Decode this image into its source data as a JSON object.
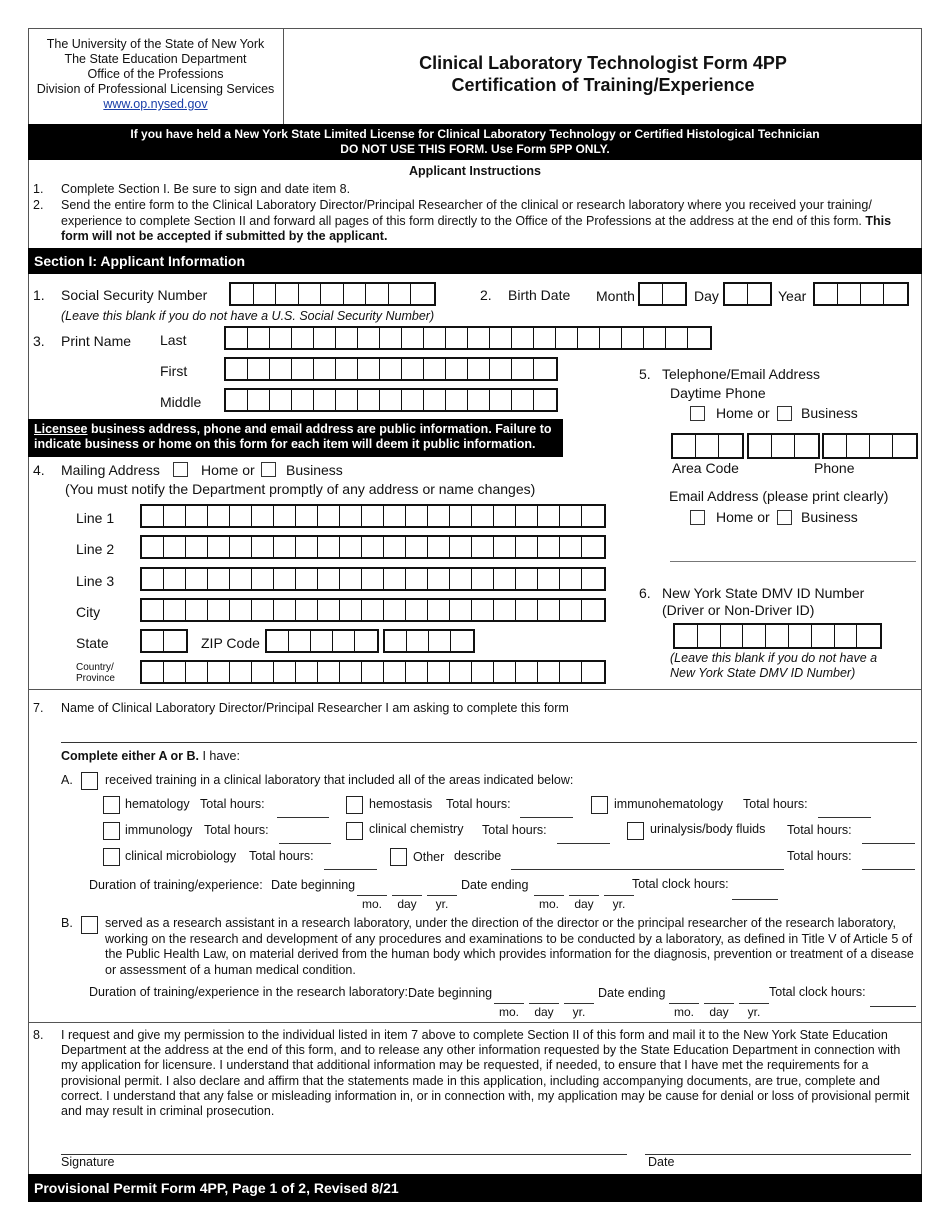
{
  "header": {
    "agency_lines": [
      "The University of the State of New York",
      "The State Education Department",
      "Office of the Professions",
      "Division of Professional Licensing Services"
    ],
    "website": "www.op.nysed.gov",
    "title_line1": "Clinical Laboratory Technologist Form 4PP",
    "title_line2": "Certification of Training/Experience"
  },
  "warning": {
    "line1": "If you have held a New York State Limited License for Clinical Laboratory Technology or Certified Histological Technician",
    "line2": "DO NOT USE THIS FORM. Use Form 5PP ONLY."
  },
  "instructions": {
    "title": "Applicant Instructions",
    "items": [
      {
        "num": "1.",
        "text": "Complete Section I. Be sure to sign and date item 8."
      },
      {
        "num": "2.",
        "text": "Send the entire form to the Clinical Laboratory Director/Principal Researcher of the clinical or research laboratory where you received your training/ experience to complete Section II and forward all pages of this form directly to the Office of the Professions at the address at the end of this form. ",
        "bold": "This form will not be accepted if submitted by the applicant."
      }
    ]
  },
  "section1": {
    "title": "Section I: Applicant Information",
    "ssn": {
      "num": "1.",
      "label": "Social Security Number",
      "note": "(Leave this blank if you do not have a U.S. Social Security Number)"
    },
    "birth": {
      "num": "2.",
      "label": "Birth Date",
      "month": "Month",
      "day": "Day",
      "year": "Year"
    },
    "name": {
      "num": "3.",
      "label": "Print Name",
      "last": "Last",
      "first": "First",
      "middle": "Middle"
    },
    "public_notice": {
      "underlined": "Licensee",
      "rest_line1": " business address, phone and email address are public information. Failure to",
      "line2": "indicate business or home on this form for each item will deem it public information."
    },
    "mailing": {
      "num": "4.",
      "label": "Mailing Address",
      "home": "Home or",
      "business": "Business",
      "note": "(You must notify the Department promptly of any address or name changes)",
      "line1": "Line 1",
      "line2": "Line 2",
      "line3": "Line 3",
      "city": "City",
      "state": "State",
      "zip": "ZIP Code",
      "country1": "Country/",
      "country2": "Province"
    },
    "telephone": {
      "num": "5.",
      "label": "Telephone/Email Address",
      "daytime": "Daytime Phone",
      "home": "Home or",
      "business": "Business",
      "area_code": "Area Code",
      "phone": "Phone",
      "email_label": "Email Address (please print clearly)"
    },
    "dmv": {
      "num": "6.",
      "label1": "New York State DMV ID Number",
      "label2": "(Driver or Non-Driver ID)",
      "note1": "(Leave this blank if you do not have a",
      "note2": "New York State DMV ID Number)"
    },
    "director": {
      "num": "7.",
      "label": "Name of Clinical Laboratory Director/Principal Researcher I am asking to complete this form"
    },
    "choice": {
      "bold": "Complete either A or B.",
      "rest": " I have:"
    },
    "option_a": {
      "letter": "A.",
      "text": "received training in a clinical laboratory that included all of the areas indicated below:",
      "total_hours": "Total hours:",
      "areas": [
        "hematology",
        "hemostasis",
        "immunohematology",
        "immunology",
        "clinical chemistry",
        "urinalysis/body fluids",
        "clinical microbiology"
      ],
      "other": "Other",
      "describe": "describe",
      "duration": "Duration of training/experience:",
      "date_begin": "Date beginning",
      "date_end": "Date ending",
      "clock_hours": "Total clock hours:",
      "mo": "mo.",
      "day": "day",
      "yr": "yr."
    },
    "option_b": {
      "letter": "B.",
      "text": "served as a research assistant in a research laboratory, under the direction of the director or the principal researcher of the research laboratory, working on the research and development of any procedures and examinations to be conducted by a laboratory, as defined in Title V of Article 5 of the Public Health Law, on material derived from the human body which provides information for the diagnosis, prevention or treatment of a disease or assessment of a human medical condition.",
      "duration": "Duration of training/experience in the research laboratory:",
      "date_begin": "Date beginning",
      "date_end": "Date ending",
      "clock_hours": "Total clock hours:"
    },
    "permission": {
      "num": "8.",
      "text": "I request and give my permission to the individual listed in item 7 above to complete Section II of this form and mail it to the New York State Education Department at the address at the end of this form, and to release any other information requested by the State Education Department in connection with my application for licensure. I understand that additional information may be requested, if needed, to ensure that I have met the requirements for a provisional permit. I also declare and affirm that the statements made in this application, including accompanying documents, are true, complete and correct. I understand that any false or misleading information in, or in connection with, my application may be cause for denial or loss of provisional permit and may result in criminal prosecution.",
      "signature": "Signature",
      "date": "Date"
    }
  },
  "footer": "Provisional Permit Form 4PP, Page 1 of 2, Revised 8/21"
}
